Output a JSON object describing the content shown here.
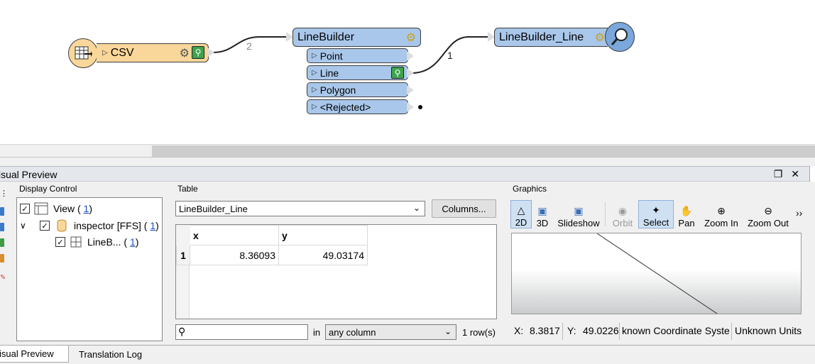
{
  "canvas": {
    "csv_node": {
      "title": "CSV"
    },
    "linebuilder_node": {
      "title": "LineBuilder",
      "ports": [
        "Point",
        "Line",
        "Polygon",
        "<Rejected>"
      ]
    },
    "inspector_node": {
      "title": "LineBuilder_Line"
    },
    "connections": {
      "csv_to_linebuilder": "2",
      "line_to_inspector": "1"
    }
  },
  "dock": {
    "title": "isual Preview",
    "display_control": {
      "label": "Display Control",
      "items": [
        {
          "label": "View",
          "count": "1"
        },
        {
          "label": "inspector [FFS]",
          "count": "1"
        },
        {
          "label": "LineB...",
          "count": "1"
        }
      ]
    },
    "table": {
      "label": "Table",
      "dataset": "LineBuilder_Line",
      "columns_button": "Columns...",
      "headers": [
        "x",
        "y"
      ],
      "rows": [
        {
          "index": "1",
          "x": "8.36093",
          "y": "49.03174"
        }
      ],
      "search_placeholder": "",
      "in_label": "in",
      "column_filter": "any column",
      "row_count": "1 row(s)"
    },
    "graphics": {
      "label": "Graphics",
      "tools": [
        {
          "label": "2D",
          "icon": "shapes-2d-icon",
          "active": true
        },
        {
          "label": "3D",
          "icon": "cube-3d-icon"
        },
        {
          "label": "Slideshow",
          "icon": "slideshow-icon"
        },
        {
          "label": "Orbit",
          "icon": "orbit-icon",
          "disabled": true
        },
        {
          "label": "Select",
          "icon": "select-icon",
          "active": true
        },
        {
          "label": "Pan",
          "icon": "hand-icon"
        },
        {
          "label": "Zoom In",
          "icon": "zoom-in-icon"
        },
        {
          "label": "Zoom Out",
          "icon": "zoom-out-icon"
        }
      ],
      "more": "››",
      "status": {
        "x_label": "X:",
        "x_value": "8.3817",
        "y_label": "Y:",
        "y_value": "49.0226",
        "crs": "known Coordinate Syste",
        "units": "Unknown Units"
      }
    }
  },
  "tabs": [
    "isual Preview",
    "Translation Log"
  ],
  "colors": {
    "reader": "#f9d79a",
    "transformer": "#a9c7ea",
    "inspector_circle": "#7aa7dc"
  }
}
